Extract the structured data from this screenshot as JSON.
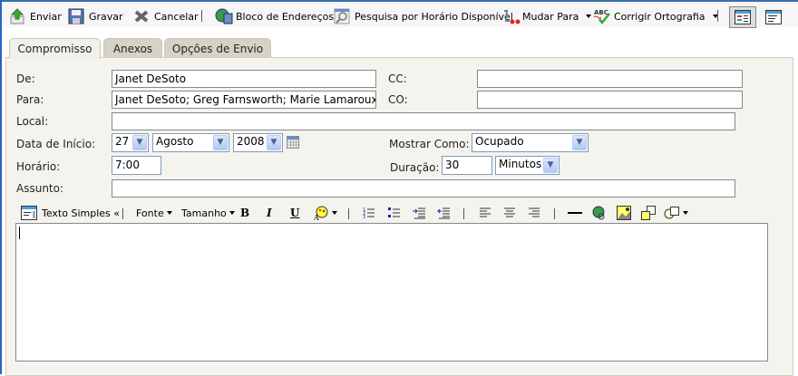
{
  "toolbar": {
    "send": "Enviar",
    "save": "Gravar",
    "cancel": "Cancelar",
    "address_book": "Bloco de Endereços",
    "free_busy": "Pesquisa por Horário Disponível",
    "move_to": "Mudar Para",
    "spell_check": "Corrigir Ortografia"
  },
  "tabs": [
    {
      "label": "Compromisso",
      "active": true
    },
    {
      "label": "Anexos"
    },
    {
      "label": "Opções de Envio"
    }
  ],
  "form": {
    "from_label": "De:",
    "from_value": "Janet DeSoto",
    "to_label": "Para:",
    "to_value": "Janet DeSoto; Greg Farnsworth; Marie Lamaroux",
    "cc_label": "CC:",
    "cc_value": "",
    "bcc_label": "CO:",
    "bcc_value": "",
    "location_label": "Local:",
    "location_value": "",
    "start_date_label": "Data de Início:",
    "day": "27",
    "month": "Agosto",
    "year": "2008",
    "show_as_label": "Mostrar Como:",
    "show_as": "Ocupado",
    "time_label": "Horário:",
    "time_value": "7:00",
    "duration_label": "Duração:",
    "duration_value": "30",
    "duration_unit": "Minutos",
    "subject_label": "Assunto:",
    "subject_value": ""
  },
  "format_toolbar": {
    "plain_text": "Texto Simples «",
    "font": "Fonte",
    "size": "Tamanho",
    "bold": "B",
    "italic": "I",
    "underline": "U"
  },
  "editor": {
    "body": ""
  }
}
